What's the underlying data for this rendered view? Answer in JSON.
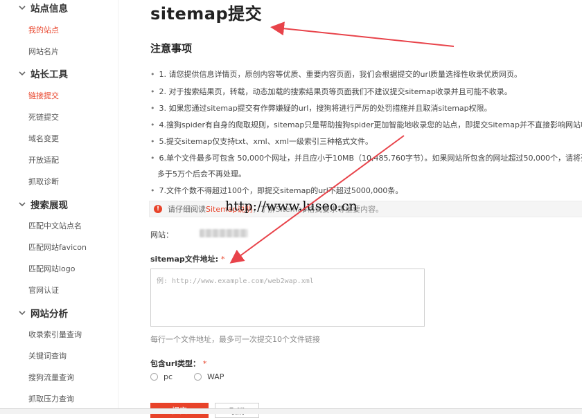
{
  "sidebar": {
    "sections": [
      {
        "label": "站点信息",
        "items": [
          "我的站点",
          "网站名片"
        ]
      },
      {
        "label": "站长工具",
        "items": [
          "链接提交",
          "死链提交",
          "域名变更",
          "开放适配",
          "抓取诊断"
        ]
      },
      {
        "label": "搜索展现",
        "items": [
          "匹配中文站点名",
          "匹配网站favicon",
          "匹配网站logo",
          "官网认证"
        ]
      },
      {
        "label": "网站分析",
        "items": [
          "收录索引量查询",
          "关键词查询",
          "搜狗流量查询",
          "抓取压力查询"
        ]
      }
    ]
  },
  "main": {
    "title": "sitemap提交",
    "notes_title": "注意事项",
    "notes": [
      "1. 请您提供信息详情页，原创内容等优质、重要内容页面，我们会根据提交的url质量选择性收录优质网页。",
      "2. 对于搜索结果页，转载，动态加载的搜索结果页等页面我们不建议提交sitemap收录并且可能不收录。",
      "3. 如果您通过sitemap提交有作弊嫌疑的url，搜狗将进行严厉的处罚措施并且取消sitemap权限。",
      "4.搜狗spider有自身的爬取规则，sitemap只是帮助搜狗spider更加智能地收录您的站点，即提交Sitemap并不直接影响网站收录",
      "5.提交sitemap仅支持txt、xml、xml一级索引三种格式文件。",
      "6.单个文件最多可包含 50,000个网址，并且应小于10MB（10,485,760字节）。如果网站所包含的网址超过50,000个，请将列",
      "多于5万个后会不再处理。",
      "7.文件个数不得超过100个，即提交sitemap的url不超过5000,000条。"
    ],
    "notice": {
      "prefix": "请仔细阅读",
      "link": "Sitemap说明",
      "rest": "，了解Sitemap格式要求等重要内容。"
    },
    "watermark": "http://www.luseo.cn",
    "site_label": "网站：",
    "sitemap_label": "sitemap文件地址:",
    "required_mark": "*",
    "sitemap_placeholder": "例: http://www.example.com/web2wap.xml",
    "hint": "每行一个文件地址，最多可一次提交10个文件链接",
    "url_type_label": "包含url类型：",
    "url_types": [
      "pc",
      "WAP"
    ],
    "submit_label": "提交",
    "cancel_label": "取消"
  },
  "colors": {
    "accent": "#e8432a",
    "arrow": "#e8434a"
  }
}
